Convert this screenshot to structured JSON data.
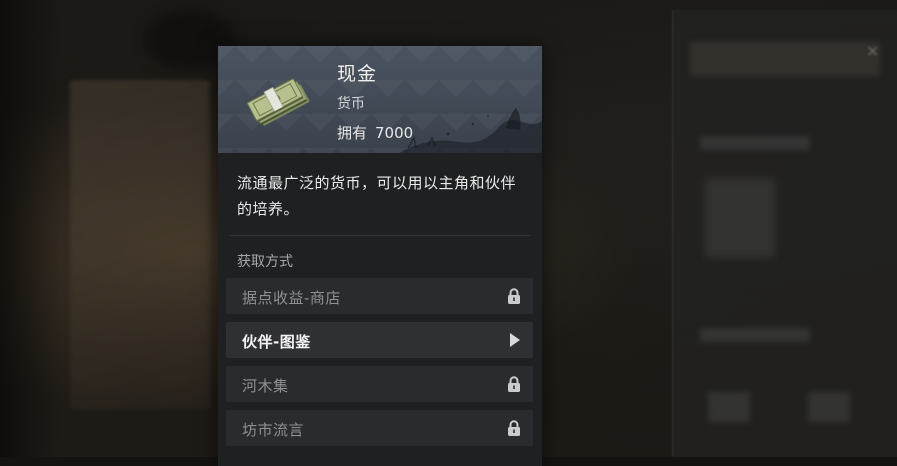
{
  "item": {
    "name": "现金",
    "type": "货币",
    "owned_label": "拥有",
    "owned_value": "7000",
    "icon": "cash-stack-icon"
  },
  "description": "流通最广泛的货币，可以用以主角和伙伴的培养。",
  "acquire": {
    "title": "获取方式",
    "sources": [
      {
        "label": "据点收益-商店",
        "locked": true,
        "icon": "lock-icon"
      },
      {
        "label": "伙伴-图鉴",
        "locked": false,
        "icon": "arrow-right-icon"
      },
      {
        "label": "河木集",
        "locked": true,
        "icon": "lock-icon"
      },
      {
        "label": "坊市流言",
        "locked": true,
        "icon": "lock-icon"
      }
    ]
  },
  "colors": {
    "header_bg": "#4a5361",
    "card_bg": "#1f2022",
    "row_bg": "#2a2b2e",
    "locked_text": "#8e9094",
    "active_text": "#f4f4f4"
  }
}
